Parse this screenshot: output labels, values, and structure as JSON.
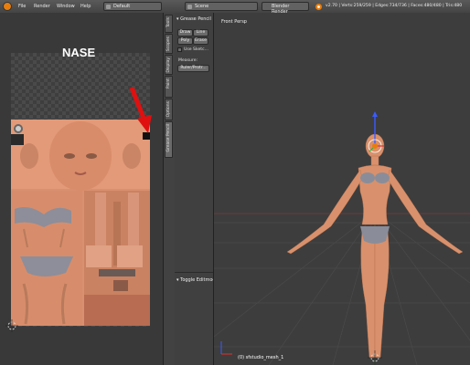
{
  "topbar": {
    "menus": [
      "File",
      "Render",
      "Window",
      "Help"
    ],
    "layout_value": "Default",
    "scene_value": "Scene",
    "engine_value": "Blender Render",
    "stats": "v2.70 | Verts:259/259 | Edges:734/736 | Faces:480/480 | Tris:480",
    "accent": "#e87d0d"
  },
  "uv_editor": {
    "overlay_text": "NASE",
    "tabs": [
      "Tools",
      "Scopes",
      "Grease Pencil",
      "Options",
      "Display",
      "Paint"
    ]
  },
  "tool_shelf": {
    "grease_panel_title": "Grease Pencil",
    "buttons": [
      "Draw",
      "Line",
      "Poly",
      "Erase"
    ],
    "use_sketch_label": "Use Sketc...",
    "measure_label": "Measure:",
    "ruler_button": "Ruler/Protr...",
    "toggle_panel": "Toggle Editmode"
  },
  "viewport": {
    "title": "Front Persp",
    "object_label": "(0) sfstudio_mesh_1"
  }
}
